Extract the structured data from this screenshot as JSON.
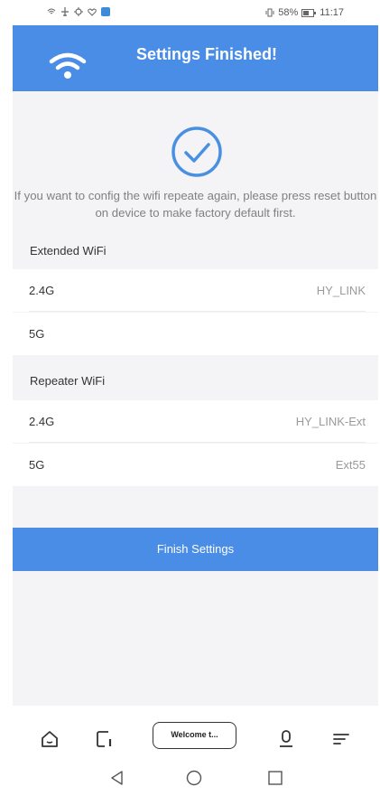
{
  "status_bar": {
    "battery": "58%",
    "time": "11:17"
  },
  "header": {
    "title": "Settings Finished!",
    "icon": "wifi-icon"
  },
  "message": "If you want to config the wifi repeate again, please press reset button on device to make factory default first.",
  "extended_wifi": {
    "heading": "Extended WiFi",
    "rows": [
      {
        "label": "2.4G",
        "value": "HY_LINK"
      },
      {
        "label": "5G",
        "value": ""
      }
    ]
  },
  "repeater_wifi": {
    "heading": "Repeater WiFi",
    "rows": [
      {
        "label": "2.4G",
        "value": "HY_LINK-Ext"
      },
      {
        "label": "5G",
        "value": "Ext55"
      }
    ]
  },
  "finish_button": "Finish Settings",
  "browser_bar": {
    "tab_label": "Welcome t...",
    "icons": [
      "home-icon",
      "tabs-icon",
      "microphone-icon",
      "menu-icon"
    ]
  },
  "nav_bar": {
    "icons": [
      "back-triangle-icon",
      "home-circle-icon",
      "recents-square-icon"
    ]
  },
  "colors": {
    "accent": "#4a8de6",
    "background": "#f4f4f6"
  }
}
